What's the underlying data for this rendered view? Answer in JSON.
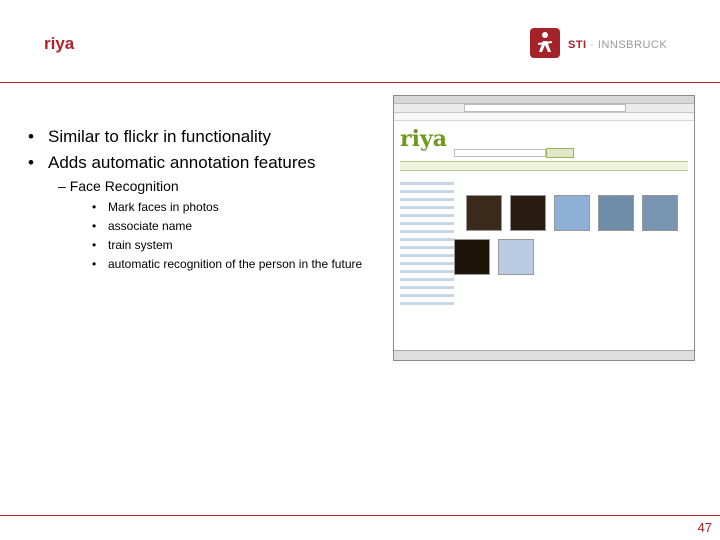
{
  "slide": {
    "title": "riya",
    "logo": {
      "sti": "STI",
      "sep": " · ",
      "place": "INNSBRUCK"
    },
    "bullets": [
      "Similar to flickr in functionality",
      "Adds automatic annotation features"
    ],
    "sub_bullet": "Face Recognition",
    "sub_sub_bullets": [
      "Mark faces in photos",
      "associate name",
      "train system",
      "automatic recognition of the person in the future"
    ],
    "page_number": "47"
  },
  "screenshot": {
    "app_logo": "riya"
  },
  "colors": {
    "accent": "#b0212b",
    "riya_green": "#6c9b1c"
  }
}
